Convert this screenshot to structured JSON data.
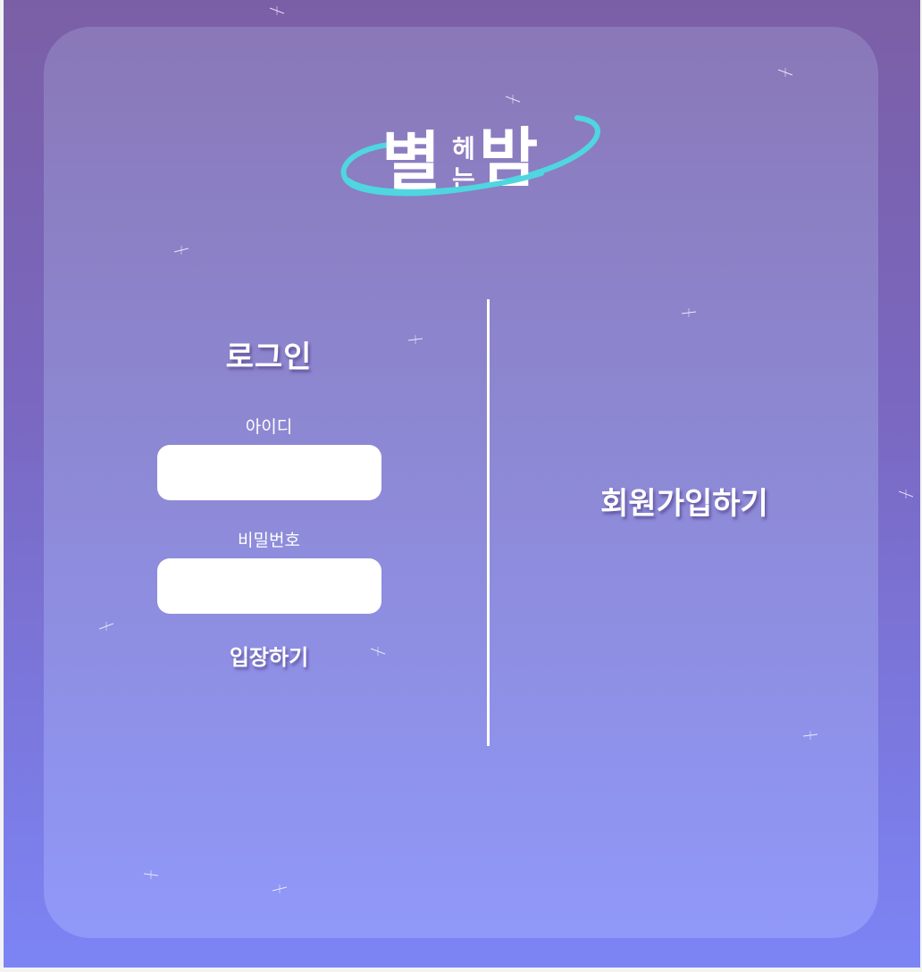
{
  "logo": {
    "big_left": "별",
    "small_top": "헤",
    "small_bottom": "는",
    "big_right": "밤",
    "ring_color": "#4fd6e0"
  },
  "login": {
    "title": "로그인",
    "id_label": "아이디",
    "id_value": "",
    "password_label": "비밀번호",
    "password_value": "",
    "submit_label": "입장하기"
  },
  "signup": {
    "label": "회원가입하기"
  },
  "theme": {
    "background_top": "#7b5fa6",
    "background_bottom": "#7c84f5",
    "card_top": "#8a78b8",
    "card_bottom": "#9098f9",
    "divider": "#ffffff"
  },
  "decor": {
    "sparkle_icon": "sparkle-icon"
  }
}
